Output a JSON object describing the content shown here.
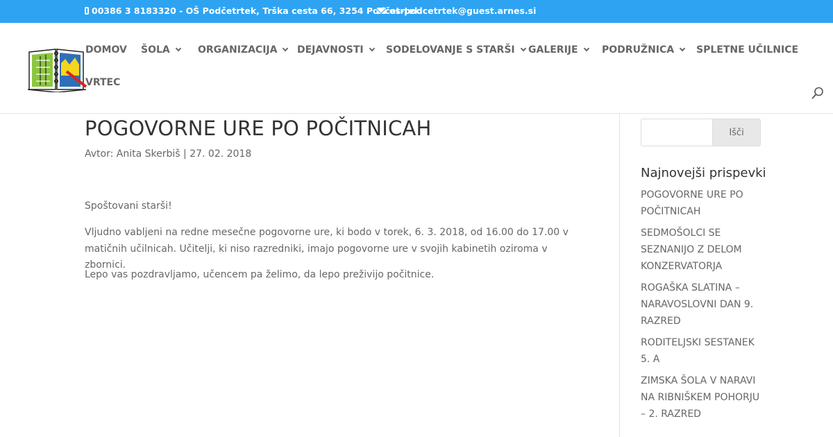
{
  "topbar": {
    "phone": "00386 3 8183320 - OŠ Podčetrtek, Trška cesta 66, 3254 Podčetrtek",
    "email": "os-podcetrtek@guest.arnes.si",
    "background": "#2ea3f2",
    "phone_icon": "phone-icon",
    "email_icon": "envelope-icon"
  },
  "header": {
    "logo_icon": "school-book-logo",
    "nav": [
      {
        "label": "DOMOV",
        "has_dropdown": false
      },
      {
        "label": "ŠOLA",
        "has_dropdown": true
      },
      {
        "label": "ORGANIZACIJA",
        "has_dropdown": true
      },
      {
        "label": "DEJAVNOSTI",
        "has_dropdown": true
      },
      {
        "label": "SODELOVANJE S STARŠI",
        "has_dropdown": true
      },
      {
        "label": "GALERIJE",
        "has_dropdown": true
      },
      {
        "label": "PODRUŽNICA",
        "has_dropdown": true
      },
      {
        "label": "SPLETNE UČILNICE",
        "has_dropdown": false
      },
      {
        "label": "VRTEC",
        "has_dropdown": false
      }
    ],
    "search_icon": "search-icon"
  },
  "post": {
    "title": "POGOVORNE URE PO POČITNICAH",
    "meta_prefix": "Avtor:",
    "author": "Anita Skerbiš",
    "separator": "|",
    "date": "27. 02. 2018",
    "paragraphs": [
      "Spoštovani starši!",
      "Vljudno vabljeni na redne mesečne pogovorne ure, ki bodo v torek, 6. 3. 2018, od 16.00 do 17.00 v matičnih učilnicah. Učitelji, ki niso razredniki, imajo pogovorne ure v svojih kabinetih oziroma v zbornici.",
      "Lepo vas pozdravljamo, učencem pa želimo, da lepo preživijo počitnice."
    ]
  },
  "sidebar": {
    "search_value": "",
    "search_button": "Išči",
    "recent_title": "Najnovejši prispevki",
    "recent_posts": [
      "POGOVORNE URE PO POČITNICAH",
      "SEDMOŠOLCI SE SEZNANIJO Z DELOM KONZERVATORJA",
      "ROGAŠKA SLATINA – NARAVOSLOVNI DAN 9. RAZRED",
      "RODITELJSKI SESTANEK 5. A",
      "ZIMSKA ŠOLA V NARAVI NA RIBNIŠKEM POHORJU – 2. RAZRED"
    ]
  }
}
